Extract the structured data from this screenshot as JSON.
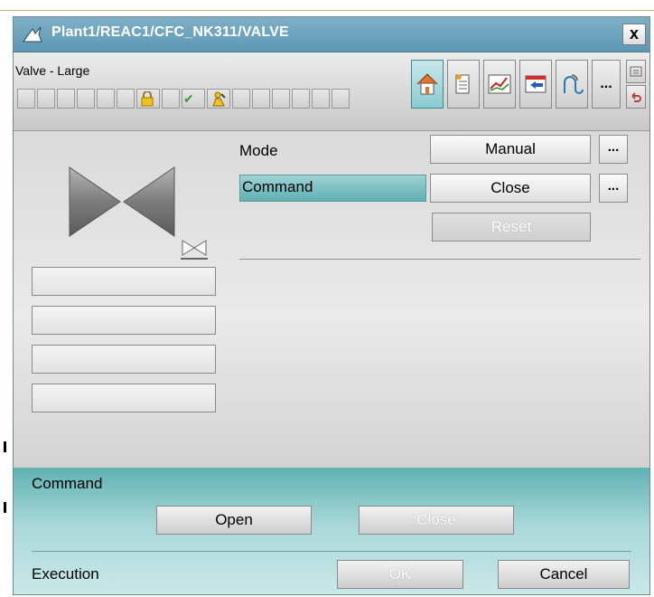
{
  "title_bar": {
    "title": "Plant1/REAC1/CFC_NK311/VALVE",
    "close_label": "x"
  },
  "toolbar": {
    "block_type": "Valve - Large",
    "more_label": "..."
  },
  "parameters": {
    "mode_label": "Mode",
    "mode_value": "Manual",
    "mode_more": "...",
    "command_label": "Command",
    "command_value": "Close",
    "command_more": "...",
    "reset_label": "Reset"
  },
  "command_section": {
    "label": "Command",
    "open_label": "Open",
    "close_label": "Close"
  },
  "execution_section": {
    "label": "Execution",
    "ok_label": "OK",
    "cancel_label": "Cancel"
  },
  "colors": {
    "title_bar": "#6aa3be",
    "accent_teal": "#5fb0b3",
    "panel_gray": "#d7d7d7"
  }
}
